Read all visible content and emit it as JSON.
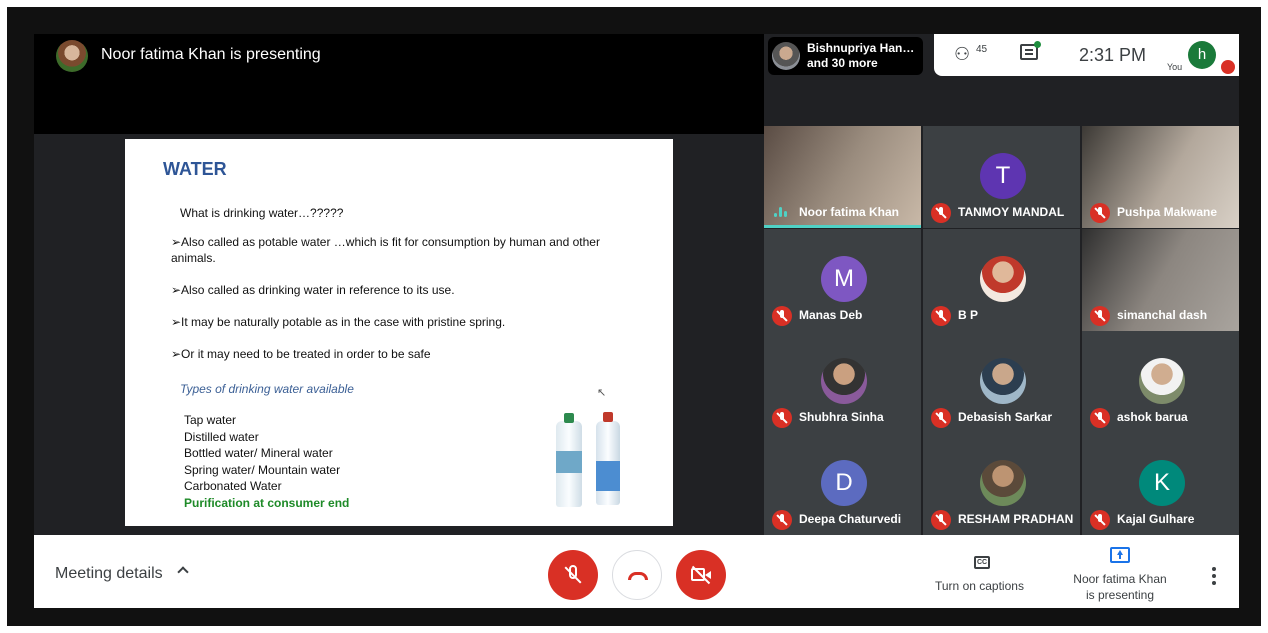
{
  "presenter": {
    "title": "Noor fatima Khan is presenting"
  },
  "slide": {
    "heading": "WATER",
    "question": "What is drinking water…?????",
    "bullets": [
      "➢Also called as potable water …which is fit for consumption by human and other animals.",
      "➢Also called as drinking water in reference to its use.",
      "➢It may be naturally potable as in the case with pristine spring.",
      "➢Or it may need to be treated in order to be safe"
    ],
    "types_title": "Types of drinking water available",
    "types": [
      "Tap water",
      "Distilled water",
      "Bottled water/ Mineral water",
      "Spring water/ Mountain water",
      "Carbonated Water"
    ],
    "types_highlight": "Purification at consumer end"
  },
  "participants_pill": {
    "name": "Bishnupriya Han…",
    "more": "and 30 more"
  },
  "topbar": {
    "people_count": "45",
    "clock": "2:31 PM",
    "you_label": "You",
    "self_initial": "h"
  },
  "tiles": [
    {
      "name": "Noor fatima Khan",
      "type": "video",
      "speaking": true
    },
    {
      "name": "TANMOY MANDAL",
      "type": "letter",
      "initial": "T",
      "color": "#5e35b1"
    },
    {
      "name": "Pushpa Makwane",
      "type": "video"
    },
    {
      "name": "Manas Deb",
      "type": "letter",
      "initial": "M",
      "color": "#7e57c2"
    },
    {
      "name": "B P",
      "type": "photo"
    },
    {
      "name": "simanchal dash",
      "type": "video"
    },
    {
      "name": "Shubhra Sinha",
      "type": "photo"
    },
    {
      "name": "Debasish Sarkar",
      "type": "photo"
    },
    {
      "name": "ashok barua",
      "type": "photo"
    },
    {
      "name": "Deepa Chaturvedi",
      "type": "letter",
      "initial": "D",
      "color": "#5c6bc0"
    },
    {
      "name": "RESHAM PRADHAN",
      "type": "photo"
    },
    {
      "name": "Kajal Gulhare",
      "type": "letter",
      "initial": "K",
      "color": "#00897b"
    }
  ],
  "bottombar": {
    "meeting_details": "Meeting details",
    "captions_label": "Turn on captions",
    "captions_icon_text": "CC",
    "present_label": "Noor fatima Khan is presenting"
  }
}
